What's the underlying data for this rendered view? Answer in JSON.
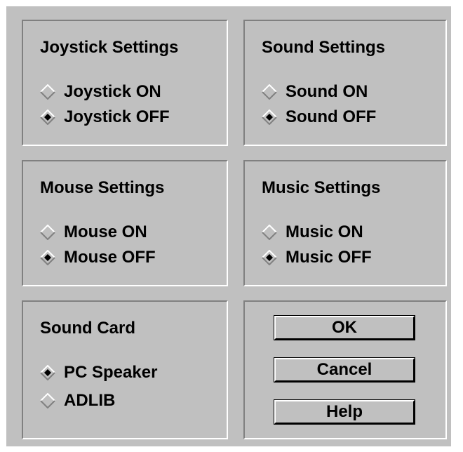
{
  "joystick": {
    "title": "Joystick Settings",
    "options": [
      {
        "label": "Joystick ON",
        "selected": false
      },
      {
        "label": "Joystick OFF",
        "selected": true
      }
    ]
  },
  "sound": {
    "title": "Sound Settings",
    "options": [
      {
        "label": "Sound ON",
        "selected": false
      },
      {
        "label": "Sound OFF",
        "selected": true
      }
    ]
  },
  "mouse": {
    "title": "Mouse Settings",
    "options": [
      {
        "label": "Mouse ON",
        "selected": false
      },
      {
        "label": "Mouse OFF",
        "selected": true
      }
    ]
  },
  "music": {
    "title": "Music Settings",
    "options": [
      {
        "label": "Music ON",
        "selected": false
      },
      {
        "label": "Music OFF",
        "selected": true
      }
    ]
  },
  "sound_card": {
    "title": "Sound Card",
    "options": [
      {
        "label": "PC Speaker",
        "selected": true
      },
      {
        "label": "ADLIB",
        "selected": false
      }
    ]
  },
  "buttons": {
    "ok": "OK",
    "cancel": "Cancel",
    "help": "Help"
  },
  "colors": {
    "face": "#c0c0c0",
    "shadow": "#808080",
    "highlight": "#ffffff",
    "text": "#000000"
  }
}
